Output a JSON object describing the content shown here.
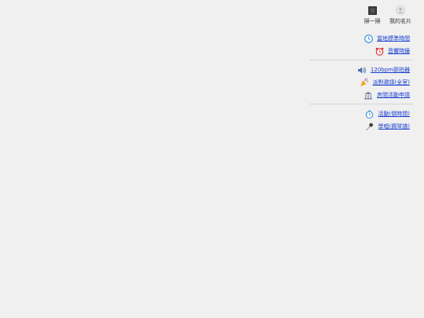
{
  "top_buttons": [
    {
      "label": "掃一掃",
      "icon": "qr-scan-icon"
    },
    {
      "label": "我的名片",
      "icon": "profile-card-icon"
    }
  ],
  "groups": [
    [
      {
        "label": "當地標準時間",
        "icon": "clock-icon"
      },
      {
        "label": "音響時鐘",
        "icon": "alarm-clock-icon"
      }
    ],
    [
      {
        "label": "120bpm節拍器",
        "icon": "speaker-icon"
      },
      {
        "label": "派對邀請(全室)",
        "icon": "party-popper-icon"
      },
      {
        "label": "房間活動申請",
        "icon": "bank-icon"
      }
    ],
    [
      {
        "label": "活動(倒時間)",
        "icon": "stopwatch-icon"
      },
      {
        "label": "學唱(鋼琴譜)",
        "icon": "microphone-icon"
      }
    ]
  ]
}
